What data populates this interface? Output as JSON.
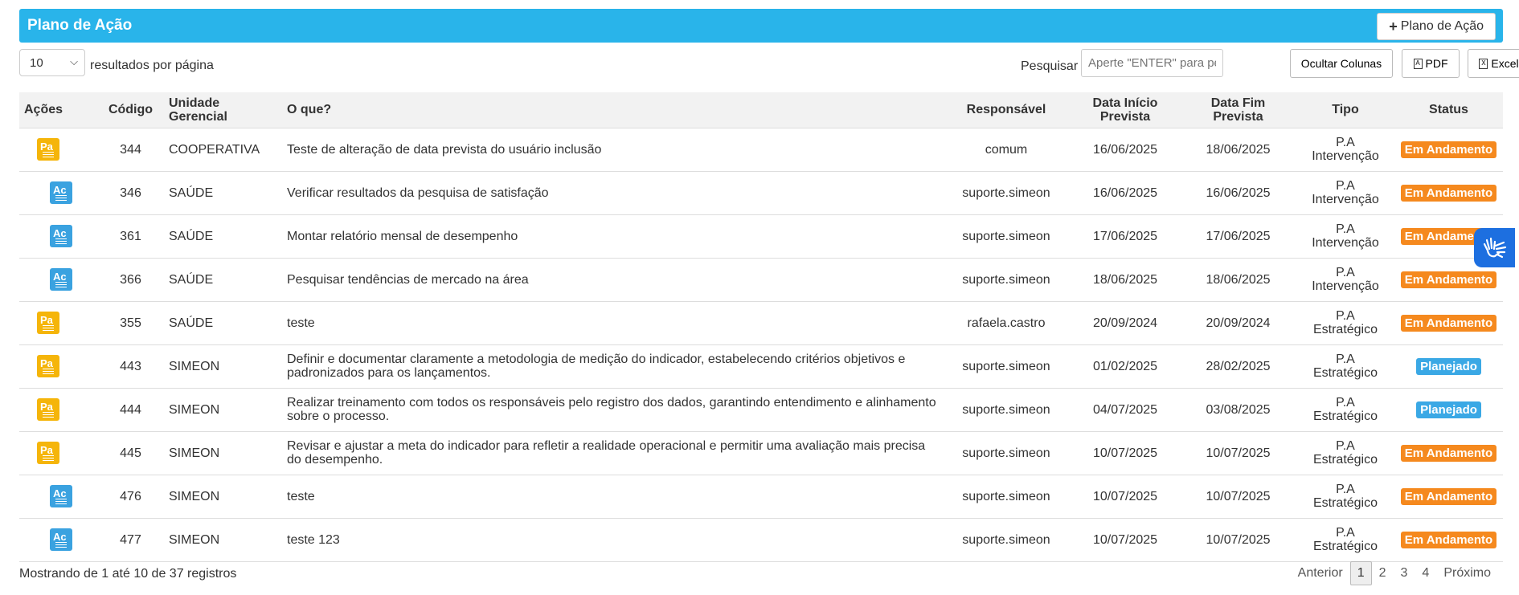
{
  "header": {
    "title": "Plano de Ação",
    "add_label": "Plano de Ação"
  },
  "toolbar": {
    "page_size": "10",
    "page_size_label": "resultados por página",
    "search_label": "Pesquisar",
    "search_placeholder": "Aperte \"ENTER\" para pesquisar",
    "hide_columns": "Ocultar Colunas",
    "pdf": "PDF",
    "excel": "Excel"
  },
  "columns": {
    "acoes": "Ações",
    "codigo": "Código",
    "unidade_l1": "Unidade",
    "unidade_l2": "Gerencial",
    "oque": "O que?",
    "responsavel": "Responsável",
    "inicio_l1": "Data Início",
    "inicio_l2": "Prevista",
    "fim_l1": "Data Fim",
    "fim_l2": "Prevista",
    "tipo": "Tipo",
    "status": "Status"
  },
  "rows": [
    {
      "icon": "Pa",
      "codigo": "344",
      "unidade": "COOPERATIVA",
      "oque": "Teste de alteração de data prevista do usuário inclusão",
      "responsavel": "comum",
      "inicio": "16/06/2025",
      "fim": "18/06/2025",
      "tipo_l1": "P.A",
      "tipo_l2": "Intervenção",
      "status": "Em Andamento"
    },
    {
      "icon": "Ac",
      "codigo": "346",
      "unidade": "SAÚDE",
      "oque": "Verificar resultados da pesquisa de satisfação",
      "responsavel": "suporte.simeon",
      "inicio": "16/06/2025",
      "fim": "16/06/2025",
      "tipo_l1": "P.A",
      "tipo_l2": "Intervenção",
      "status": "Em Andamento"
    },
    {
      "icon": "Ac",
      "codigo": "361",
      "unidade": "SAÚDE",
      "oque": "Montar relatório mensal de desempenho",
      "responsavel": "suporte.simeon",
      "inicio": "17/06/2025",
      "fim": "17/06/2025",
      "tipo_l1": "P.A",
      "tipo_l2": "Intervenção",
      "status": "Em Andamento"
    },
    {
      "icon": "Ac",
      "codigo": "366",
      "unidade": "SAÚDE",
      "oque": "Pesquisar tendências de mercado na área",
      "responsavel": "suporte.simeon",
      "inicio": "18/06/2025",
      "fim": "18/06/2025",
      "tipo_l1": "P.A",
      "tipo_l2": "Intervenção",
      "status": "Em Andamento"
    },
    {
      "icon": "Pa",
      "codigo": "355",
      "unidade": "SAÚDE",
      "oque": "teste",
      "responsavel": "rafaela.castro",
      "inicio": "20/09/2024",
      "fim": "20/09/2024",
      "tipo_l1": "P.A",
      "tipo_l2": "Estratégico",
      "status": "Em Andamento"
    },
    {
      "icon": "Pa",
      "codigo": "443",
      "unidade": "SIMEON",
      "oque": "Definir e documentar claramente a metodologia de medição do indicador, estabelecendo critérios objetivos e padronizados para os lançamentos.",
      "responsavel": "suporte.simeon",
      "inicio": "01/02/2025",
      "fim": "28/02/2025",
      "tipo_l1": "P.A",
      "tipo_l2": "Estratégico",
      "status": "Planejado"
    },
    {
      "icon": "Pa",
      "codigo": "444",
      "unidade": "SIMEON",
      "oque": "Realizar treinamento com todos os responsáveis pelo registro dos dados, garantindo entendimento e alinhamento sobre o processo.",
      "responsavel": "suporte.simeon",
      "inicio": "04/07/2025",
      "fim": "03/08/2025",
      "tipo_l1": "P.A",
      "tipo_l2": "Estratégico",
      "status": "Planejado"
    },
    {
      "icon": "Pa",
      "codigo": "445",
      "unidade": "SIMEON",
      "oque": "Revisar e ajustar a meta do indicador para refletir a realidade operacional e permitir uma avaliação mais precisa do desempenho.",
      "responsavel": "suporte.simeon",
      "inicio": "10/07/2025",
      "fim": "10/07/2025",
      "tipo_l1": "P.A",
      "tipo_l2": "Estratégico",
      "status": "Em Andamento"
    },
    {
      "icon": "Ac",
      "codigo": "476",
      "unidade": "SIMEON",
      "oque": "teste",
      "responsavel": "suporte.simeon",
      "inicio": "10/07/2025",
      "fim": "10/07/2025",
      "tipo_l1": "P.A",
      "tipo_l2": "Estratégico",
      "status": "Em Andamento"
    },
    {
      "icon": "Ac",
      "codigo": "477",
      "unidade": "SIMEON",
      "oque": "teste 123",
      "responsavel": "suporte.simeon",
      "inicio": "10/07/2025",
      "fim": "10/07/2025",
      "tipo_l1": "P.A",
      "tipo_l2": "Estratégico",
      "status": "Em Andamento"
    }
  ],
  "footer": {
    "info": "Mostrando de 1 até 10 de 37 registros",
    "prev": "Anterior",
    "pages": [
      "1",
      "2",
      "3",
      "4"
    ],
    "next": "Próximo"
  },
  "colors": {
    "header": "#29b4ea",
    "em_andamento": "#f5891e",
    "planejado": "#3aa8e5",
    "pa_icon": "#f5b50a",
    "ac_icon": "#3aa2e0",
    "a11y": "#1d6fe0"
  },
  "icons": {
    "add": "plus-icon",
    "pdf": "pdf-file-icon",
    "excel": "excel-file-icon",
    "a11y": "hand-sign-language-icon"
  }
}
